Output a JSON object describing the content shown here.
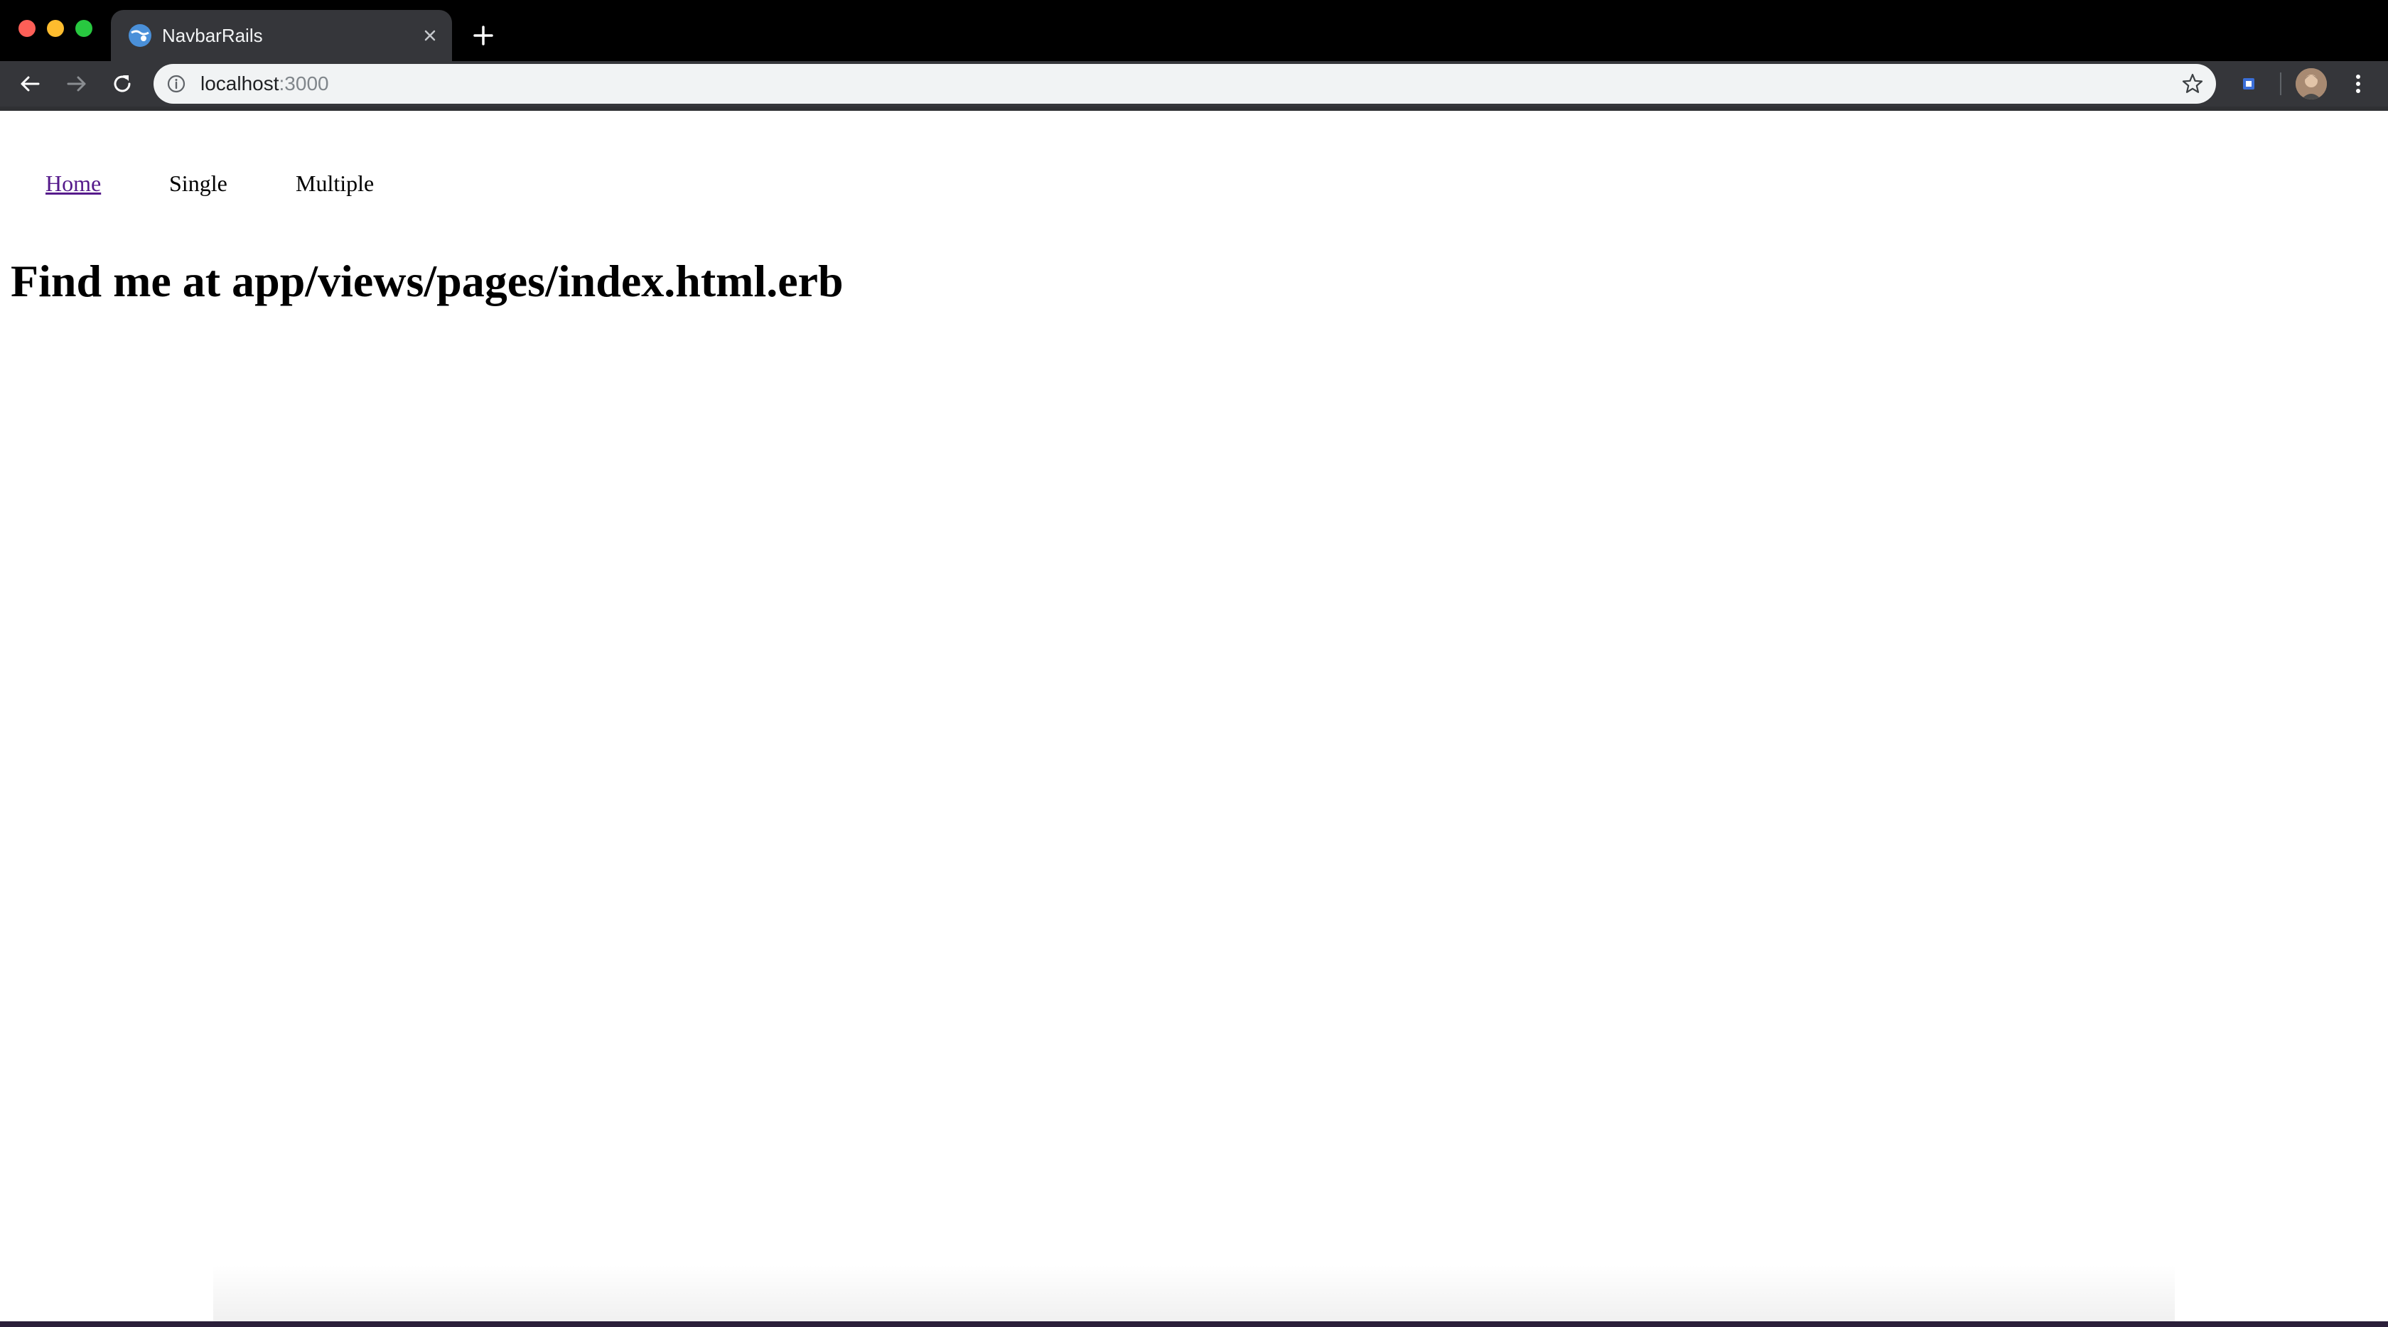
{
  "browser": {
    "tab": {
      "title": "NavbarRails",
      "favicon": "globe-icon"
    },
    "address_bar": {
      "host": "localhost",
      "port": ":3000"
    },
    "icons": {
      "back": "arrow-left-icon",
      "forward": "arrow-right-icon",
      "reload": "reload-icon",
      "info": "info-icon",
      "bookmark": "star-icon",
      "extension": "extension-icon",
      "menu": "kebab-menu-icon",
      "new_tab": "plus-icon",
      "close_tab": "close-icon"
    },
    "colors": {
      "tab_strip": "#000000",
      "tab_active": "#35363a",
      "omnibox": "#f1f3f4",
      "visited_link": "#551a8b"
    }
  },
  "page": {
    "nav": [
      {
        "label": "Home"
      },
      {
        "label": "Single"
      },
      {
        "label": "Multiple"
      }
    ],
    "heading": "Find me at app/views/pages/index.html.erb"
  }
}
